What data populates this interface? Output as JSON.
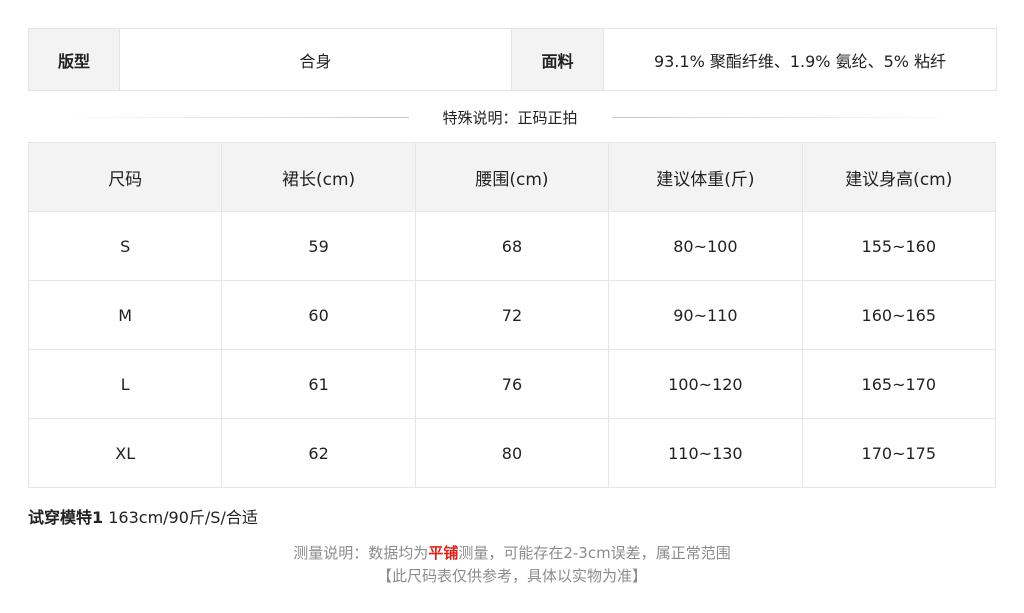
{
  "info": {
    "fit_label": "版型",
    "fit_value": "合身",
    "fabric_label": "面料",
    "fabric_value": "93.1% 聚酯纤维、1.9% 氨纶、5% 粘纤"
  },
  "special_note": "特殊说明：正码正拍",
  "size_table": {
    "headers": [
      "尺码",
      "裙长(cm)",
      "腰围(cm)",
      "建议体重(斤)",
      "建议身高(cm)"
    ],
    "rows": [
      [
        "S",
        "59",
        "68",
        "80~100",
        "155~160"
      ],
      [
        "M",
        "60",
        "72",
        "90~110",
        "160~165"
      ],
      [
        "L",
        "61",
        "76",
        "100~120",
        "165~170"
      ],
      [
        "XL",
        "62",
        "80",
        "110~130",
        "170~175"
      ]
    ]
  },
  "model": {
    "label": "试穿模特1",
    "value": "163cm/90斤/S/合适"
  },
  "measurement_note": {
    "prefix": "测量说明：数据均为",
    "highlight": "平铺",
    "suffix": "测量，可能存在2-3cm误差，属正常范围",
    "disclaimer": "【此尺码表仅供参考，具体以实物为准】"
  },
  "colors": {
    "highlight": "#e0231b",
    "header_bg": "#f3f3f3",
    "border": "#e6e6e6"
  }
}
